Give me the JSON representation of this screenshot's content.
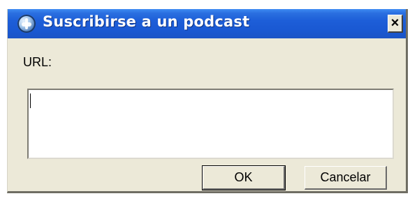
{
  "window": {
    "title": "Suscribirse a un podcast",
    "close_symbol": "×",
    "icon": "itunes-app-icon"
  },
  "form": {
    "url_label": "URL:",
    "url_value": ""
  },
  "buttons": {
    "ok_label": "OK",
    "cancel_label": "Cancelar"
  },
  "colors": {
    "titlebar": "#1a59d3",
    "dialog_background": "#ece9d8"
  }
}
